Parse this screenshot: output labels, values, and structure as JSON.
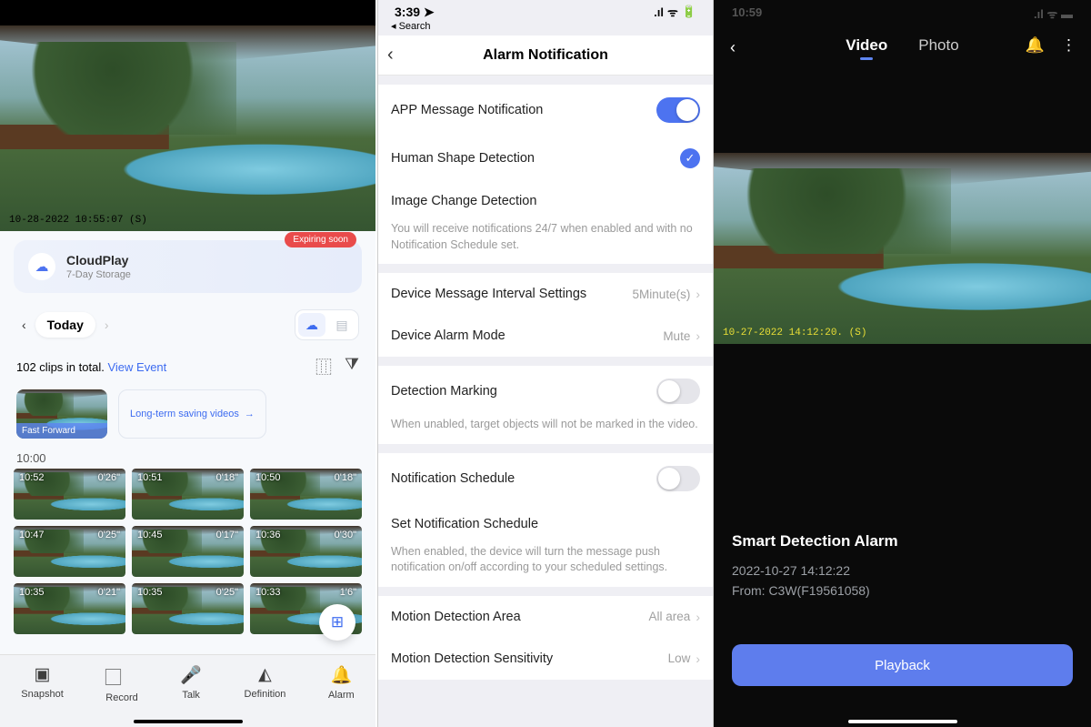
{
  "phone1": {
    "hero_ts": "10-28-2022 10:55:07 (S)",
    "cloud": {
      "title": "CloudPlay",
      "sub": "7-Day Storage",
      "badge": "Expiring soon"
    },
    "day": {
      "label": "Today"
    },
    "clips_total": "102 clips in total.",
    "view_event": "View Event",
    "promo_ff": "Fast Forward",
    "promo_long": "Long-term saving videos",
    "hour": "10:00",
    "clips": [
      {
        "t": "10:52",
        "d": "0'26\""
      },
      {
        "t": "10:51",
        "d": "0'18\""
      },
      {
        "t": "10:50",
        "d": "0'18\""
      },
      {
        "t": "10:47",
        "d": "0'25\""
      },
      {
        "t": "10:45",
        "d": "0'17\""
      },
      {
        "t": "10:36",
        "d": "0'30\""
      },
      {
        "t": "10:35",
        "d": "0'21\""
      },
      {
        "t": "10:35",
        "d": "0'25\""
      },
      {
        "t": "10:33",
        "d": "1'6\""
      }
    ],
    "bar": {
      "snapshot": "Snapshot",
      "record": "Record",
      "talk": "Talk",
      "definition": "Definition",
      "alarm": "Alarm"
    }
  },
  "phone2": {
    "status_time": "3:39",
    "back_search": "◂ Search",
    "title": "Alarm Notification",
    "row_app_msg": "APP Message Notification",
    "row_human": "Human Shape Detection",
    "row_imgchange": "Image Change Detection",
    "help_imgchange": "You will receive notifications 24/7 when enabled and with no Notification Schedule set.",
    "row_interval": "Device Message Interval Settings",
    "val_interval": "5Minute(s)",
    "row_alarmmode": "Device Alarm Mode",
    "val_alarmmode": "Mute",
    "row_detmark": "Detection Marking",
    "help_detmark": "When unabled, target objects will not be marked in the video.",
    "row_notifsched": "Notification Schedule",
    "row_setnotif": "Set Notification Schedule",
    "help_setnotif": "When enabled, the device will turn the message push notification on/off according to your scheduled settings.",
    "row_area": "Motion Detection Area",
    "val_area": "All area",
    "row_sens": "Motion Detection Sensitivity",
    "val_sens": "Low"
  },
  "phone3": {
    "status_time": "10:59",
    "tab_video": "Video",
    "tab_photo": "Photo",
    "hero_ts": "10-27-2022 14:12:20. (S)",
    "alarm_title": "Smart Detection Alarm",
    "alarm_time": "2022-10-27 14:12:22",
    "alarm_from": "From: C3W(F19561058)",
    "cta": "Playback"
  }
}
